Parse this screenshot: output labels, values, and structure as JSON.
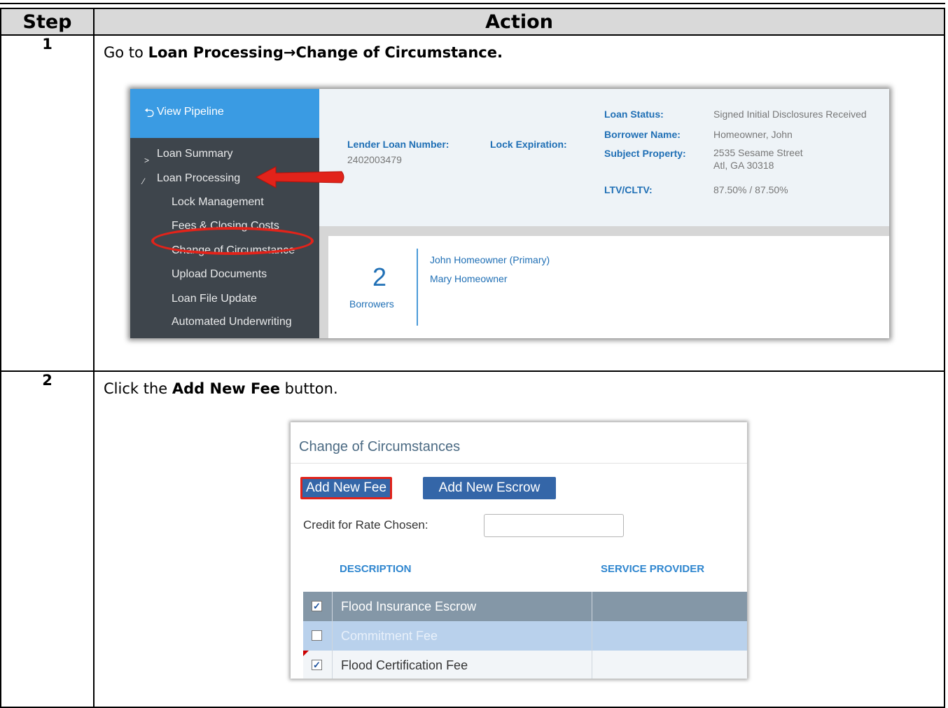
{
  "table": {
    "header": {
      "step": "Step",
      "action": "Action"
    },
    "rows": [
      {
        "step": "1",
        "instruction": {
          "prefix": "Go to ",
          "bold": "Loan Processing→Change of Circumstance.",
          "suffix": ""
        },
        "screenshot": {
          "view_pipeline": "View Pipeline",
          "nav": {
            "loan_summary": "Loan Summary",
            "loan_processing": "Loan Processing",
            "lock_management": "Lock Management",
            "fees_closing": "Fees & Closing Costs",
            "change_of_circumstance": "Change of Circumstance",
            "upload_documents": "Upload Documents",
            "loan_file_update": "Loan File Update",
            "automated_underwriting": "Automated Underwriting"
          },
          "loan": {
            "lender_loan_number_label": "Lender Loan Number:",
            "lender_loan_number": "2402003479",
            "lock_expiration_label": "Lock Expiration:",
            "loan_status_label": "Loan Status:",
            "loan_status": "Signed Initial Disclosures Received",
            "borrower_name_label": "Borrower Name:",
            "borrower_name": "Homeowner, John",
            "subject_property_label": "Subject Property:",
            "subject_property_line1": "2535 Sesame Street",
            "subject_property_line2": "Atl, GA 30318",
            "ltv_label": "LTV/CLTV:",
            "ltv": "87.50% / 87.50%"
          },
          "borrowers": {
            "count": "2",
            "label": "Borrowers",
            "names": [
              "John Homeowner (Primary)",
              "Mary Homeowner"
            ]
          },
          "colors": {
            "sidebar": "#3e454c",
            "accent": "#3a9be3",
            "highlight": "#e2231a"
          }
        }
      },
      {
        "step": "2",
        "instruction": {
          "prefix": "Click the ",
          "bold": "Add New Fee",
          "suffix": " button."
        },
        "screenshot": {
          "title": "Change of Circumstances",
          "add_new_fee": "Add New Fee",
          "add_new_escrow": "Add New Escrow",
          "credit_label": "Credit for Rate Chosen:",
          "credit_value": "",
          "columns": [
            "DESCRIPTION",
            "SERVICE PROVIDER"
          ],
          "fees": [
            {
              "name": "Flood Insurance Escrow",
              "checked": true
            },
            {
              "name": "Commitment Fee",
              "checked": false
            },
            {
              "name": "Flood Certification Fee",
              "checked": true
            }
          ],
          "colors": {
            "button": "#3466a8",
            "row_dark": "#8497a7",
            "row_light": "#b9d1ec"
          }
        }
      }
    ]
  }
}
